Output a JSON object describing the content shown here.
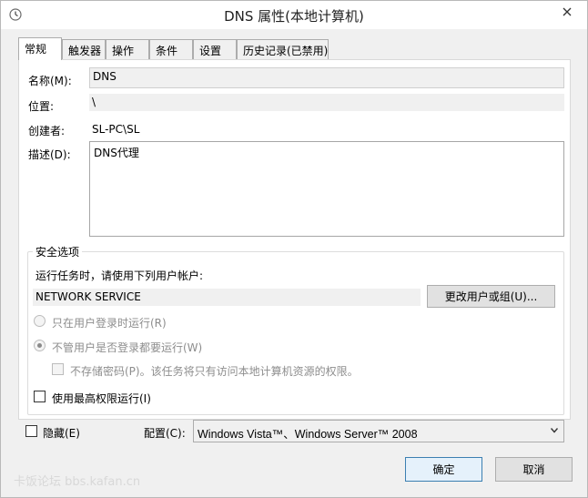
{
  "window": {
    "title": "DNS 属性(本地计算机)"
  },
  "tabs": [
    {
      "label": "常规"
    },
    {
      "label": "触发器"
    },
    {
      "label": "操作"
    },
    {
      "label": "条件"
    },
    {
      "label": "设置"
    },
    {
      "label": "历史记录(已禁用)"
    }
  ],
  "general": {
    "name_label": "名称(M):",
    "name_value": "DNS",
    "location_label": "位置:",
    "location_value": "\\",
    "author_label": "创建者:",
    "author_value": "SL-PC\\SL",
    "description_label": "描述(D):",
    "description_value": "DNS代理"
  },
  "security": {
    "group_title": "安全选项",
    "run_as_prompt": "运行任务时，请使用下列用户帐户:",
    "account": "NETWORK SERVICE",
    "change_user_button": "更改用户或组(U)...",
    "radio_logged_on": "只在用户登录时运行(R)",
    "radio_whether_logged": "不管用户是否登录都要运行(W)",
    "no_store_password": "不存储密码(P)。该任务将只有访问本地计算机资源的权限。",
    "highest_privileges": "使用最高权限运行(I)"
  },
  "bottom": {
    "hidden_label": "隐藏(E)",
    "configure_label": "配置(C):",
    "configure_value": "Windows Vista™、Windows Server™ 2008"
  },
  "buttons": {
    "ok": "确定",
    "cancel": "取消"
  },
  "watermark": "卡饭论坛 bbs.kafan.cn",
  "icons": {
    "title_icon": "clock-icon",
    "close": "close-icon",
    "dropdown": "chevron-down-icon"
  }
}
